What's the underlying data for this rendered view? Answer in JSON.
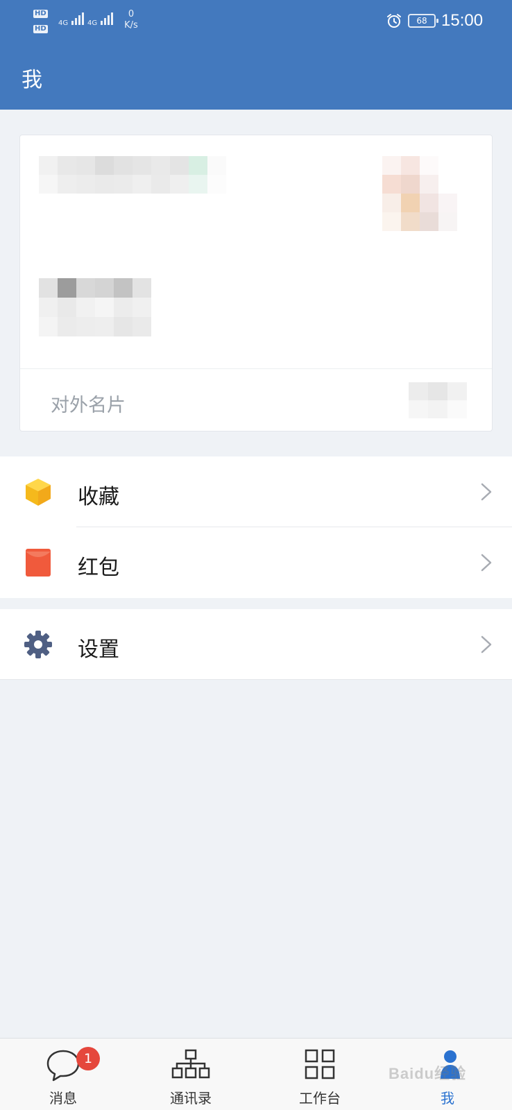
{
  "status_bar": {
    "hd_label": "HD",
    "network": "4G",
    "speed_value": "0",
    "speed_unit": "K/s",
    "battery": "68",
    "time": "15:00",
    "icons": [
      "hd-icon",
      "signal-icon",
      "alarm-icon",
      "battery-icon"
    ]
  },
  "header": {
    "title": "我"
  },
  "profile_card": {
    "external_card_label": "对外名片",
    "icons": [
      "redacted-name",
      "redacted-avatar",
      "redacted-company",
      "redacted-value"
    ]
  },
  "menu": {
    "groups": [
      {
        "items": [
          {
            "label": "收藏",
            "icon": "favorites-box-icon",
            "color": "#f7c125"
          },
          {
            "label": "红包",
            "icon": "red-packet-icon",
            "color": "#f05a3c"
          }
        ]
      },
      {
        "items": [
          {
            "label": "设置",
            "icon": "gear-icon",
            "color": "#4f5f83"
          }
        ]
      }
    ]
  },
  "bottom_nav": {
    "items": [
      {
        "label": "消息",
        "icon": "chat-bubble-icon",
        "badge": "1"
      },
      {
        "label": "通讯录",
        "icon": "org-chart-icon"
      },
      {
        "label": "工作台",
        "icon": "grid-icon"
      },
      {
        "label": "我",
        "icon": "person-icon",
        "active": true
      }
    ]
  },
  "watermark": {
    "text": "Baidu经验"
  },
  "colors": {
    "header_bg": "#4379be",
    "page_bg": "#eff2f6",
    "active_tab": "#2a72d0",
    "badge": "#e5473c"
  }
}
